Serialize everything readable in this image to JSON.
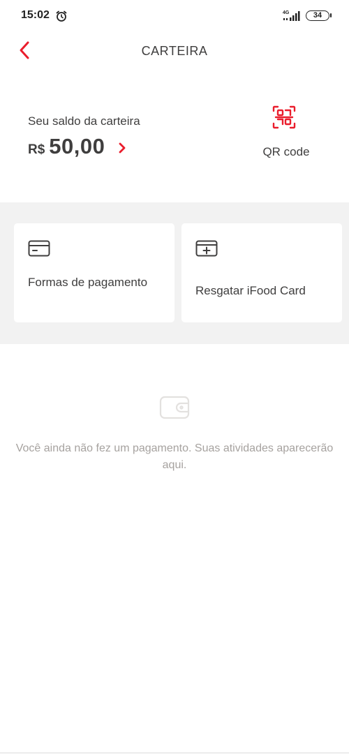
{
  "status_bar": {
    "time": "15:02",
    "network": "4G",
    "battery": "34"
  },
  "header": {
    "title": "CARTEIRA"
  },
  "balance": {
    "label": "Seu saldo da carteira",
    "currency": "R$",
    "amount": "50,00"
  },
  "qr": {
    "label": "QR code"
  },
  "cards": {
    "payment_label": "Formas de pagamento",
    "redeem_label": "Resgatar iFood Card"
  },
  "empty_state": {
    "text": "Você ainda não fez um pagamento. Suas atividades aparecerão aqui."
  },
  "colors": {
    "accent": "#ea1d2c",
    "text": "#3f3e3e",
    "muted": "#a6a29f",
    "section_bg": "#f2f2f2"
  },
  "icons": [
    "alarm-icon",
    "signal-icon",
    "battery-icon",
    "back-arrow-icon",
    "chevron-right-icon",
    "qr-code-icon",
    "credit-card-icon",
    "add-card-icon",
    "wallet-icon"
  ]
}
